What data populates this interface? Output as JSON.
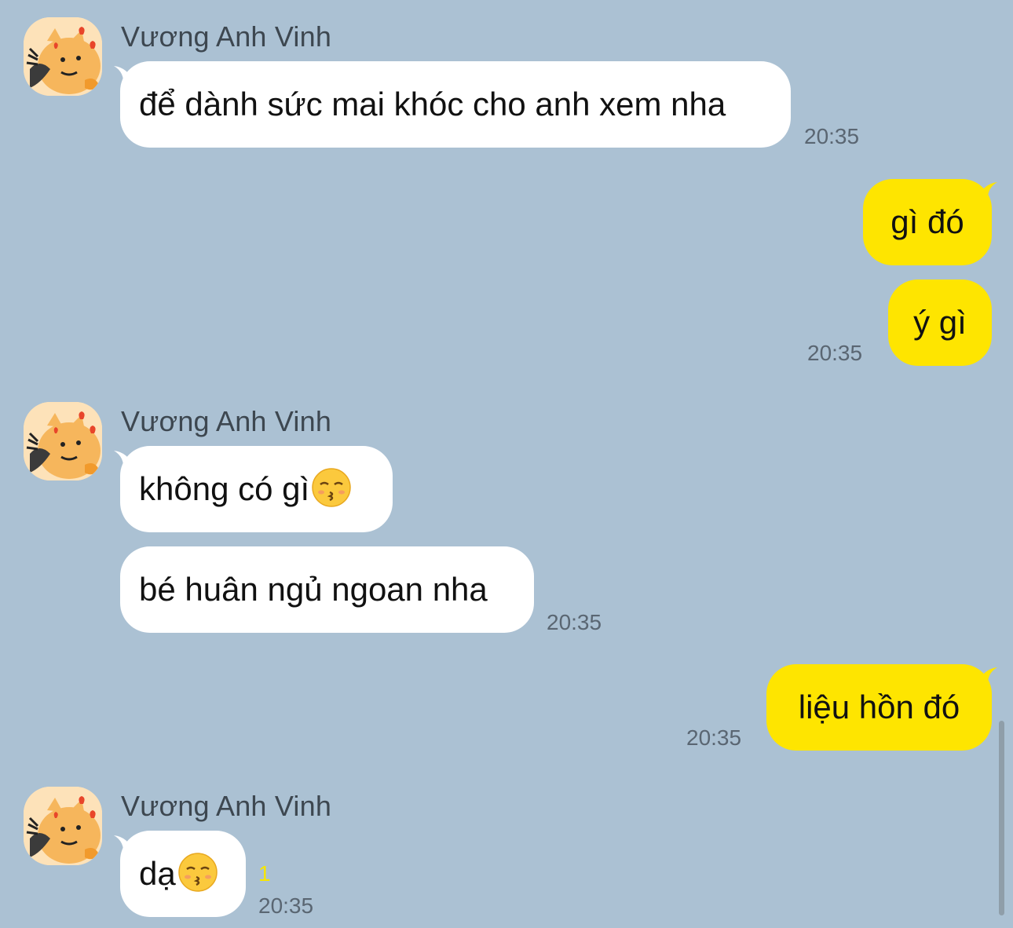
{
  "chat": {
    "sender_name": "Vương Anh Vinh",
    "unread_count": "1",
    "messages": [
      {
        "direction": "in",
        "text": "để dành sức mai khóc cho anh xem nha",
        "time": "20:35"
      },
      {
        "direction": "out",
        "text": "gì đó"
      },
      {
        "direction": "out",
        "text": "ý gì",
        "time": "20:35"
      },
      {
        "direction": "in",
        "text": "không có gì",
        "emoji": "kissing-face-emoji"
      },
      {
        "direction": "in",
        "text": "bé huân ngủ ngoan nha",
        "time": "20:35"
      },
      {
        "direction": "out",
        "text": "liệu hồn đó",
        "time": "20:35"
      },
      {
        "direction": "in",
        "text": "dạ",
        "emoji": "kissing-face-emoji",
        "time": "20:35"
      }
    ]
  },
  "colors": {
    "background": "#abc1d3",
    "incoming_bubble": "#ffffff",
    "outgoing_bubble": "#fee500",
    "unread_indicator": "#f7e600"
  }
}
